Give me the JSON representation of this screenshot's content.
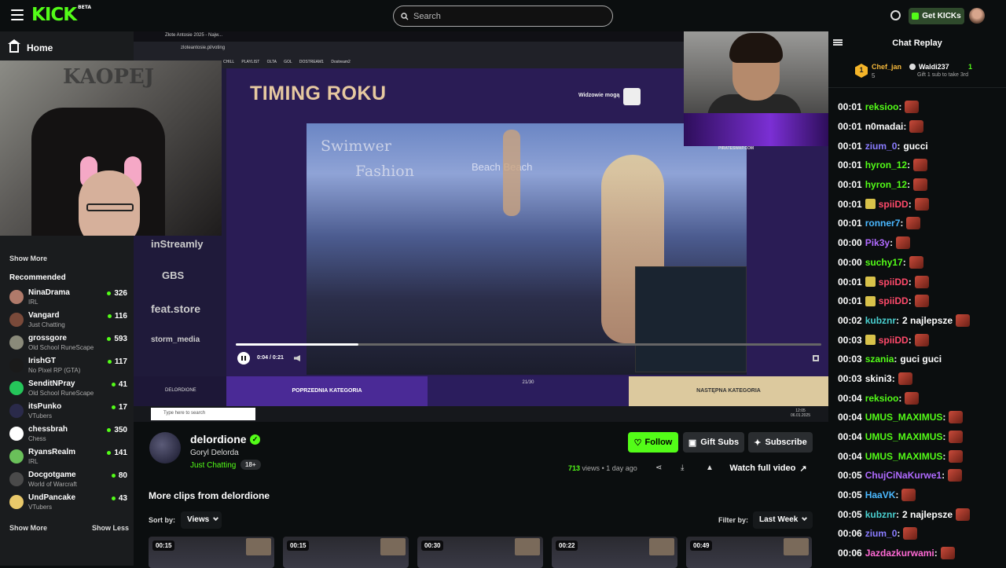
{
  "header": {
    "logo": "KICK",
    "logo_tag": "BETA",
    "search_placeholder": "Search",
    "get_kicks": "Get KICKs"
  },
  "sidebar": {
    "home": "Home",
    "show_more_top": "Show More",
    "recommended_title": "Recommended",
    "recommended": [
      {
        "name": "NinaDrama",
        "category": "IRL",
        "viewers": "326",
        "color": "#b07a6a"
      },
      {
        "name": "Vangard",
        "category": "Just Chatting",
        "viewers": "116",
        "color": "#7a4a3a"
      },
      {
        "name": "grossgore",
        "category": "Old School RuneScape",
        "viewers": "593",
        "color": "#8a8a7a"
      },
      {
        "name": "IrishGT",
        "category": "No Pixel RP (GTA)",
        "viewers": "117",
        "color": "#1a1a1a"
      },
      {
        "name": "SenditNPray",
        "category": "Old School RuneScape",
        "viewers": "41",
        "color": "#25c55a"
      },
      {
        "name": "itsPunko",
        "category": "VTubers",
        "viewers": "17",
        "color": "#2a2a4a"
      },
      {
        "name": "chessbrah",
        "category": "Chess",
        "viewers": "350",
        "color": "#ffffff"
      },
      {
        "name": "RyansRealm",
        "category": "IRL",
        "viewers": "141",
        "color": "#6ac05a"
      },
      {
        "name": "Docgotgame",
        "category": "World of Warcraft",
        "viewers": "80",
        "color": "#4a4a4a"
      },
      {
        "name": "UndPancake",
        "category": "VTubers",
        "viewers": "43",
        "color": "#e8c86a"
      }
    ],
    "show_more": "Show More",
    "show_less": "Show Less"
  },
  "video": {
    "browser_tab": "Złote Antosie 2025 - Najw...",
    "url": "zloteantosie.pl/voting",
    "bookmarks": "CHILL PLAYLIST  OLTA  GOL  DOSTREAM1  Dostream2",
    "title": "TIMING ROKU",
    "viewers_can": "Widzowie mogą",
    "runway_text1": "Swimwer",
    "runway_text2": "Fashion",
    "runway_text3": "Beach Beach",
    "brands": [
      "inStreamly",
      "GBS",
      "feat.store",
      "storm_media"
    ],
    "time": "0:04 / 0:21",
    "progress_fraction": 0.21,
    "nav_left": "DELORDIONE",
    "nav_prev": "POPRZEDNIA KATEGORIA",
    "nav_counter": "21/30",
    "nav_next": "NASTĘPNA KATEGORIA",
    "taskbar_search": "Type here to search",
    "taskbar_time": "12:05",
    "taskbar_date": "06.01.2025",
    "cam_caption": "PIRATESWAP.COM",
    "poster_text": "KAOPEJ"
  },
  "chat": {
    "title": "Chat Replay",
    "top_gifters": [
      {
        "rank": "1",
        "name": "Chef_jan",
        "count": "5"
      },
      {
        "name": "Waldi237",
        "count": "1",
        "note": "Gift 1 sub to take 3rd"
      }
    ],
    "messages": [
      {
        "time": "00:01",
        "user": "reksioo",
        "color": "#53fc18",
        "text": "",
        "emote": true
      },
      {
        "time": "00:01",
        "user": "n0madai",
        "color": "#ffffff",
        "text": "",
        "emote": true
      },
      {
        "time": "00:01",
        "user": "zium_0",
        "color": "#8a7cff",
        "text": "gucci",
        "emote": false
      },
      {
        "time": "00:01",
        "user": "hyron_12",
        "color": "#53fc18",
        "text": "",
        "emote": true
      },
      {
        "time": "00:01",
        "user": "hyron_12",
        "color": "#53fc18",
        "text": "",
        "emote": true
      },
      {
        "time": "00:01",
        "user": "spiiDD",
        "color": "#ff4a6a",
        "text": "",
        "emote": true,
        "badge": true
      },
      {
        "time": "00:01",
        "user": "ronner7",
        "color": "#4ab8ff",
        "text": "",
        "emote": true
      },
      {
        "time": "00:00",
        "user": "Pik3y",
        "color": "#b06aff",
        "text": "",
        "emote": true
      },
      {
        "time": "00:00",
        "user": "suchy17",
        "color": "#53fc18",
        "text": "",
        "emote": true
      },
      {
        "time": "00:01",
        "user": "spiiDD",
        "color": "#ff4a6a",
        "text": "",
        "emote": true,
        "badge": true
      },
      {
        "time": "00:01",
        "user": "spiiDD",
        "color": "#ff4a6a",
        "text": "",
        "emote": true,
        "badge": true
      },
      {
        "time": "00:02",
        "user": "kubznr",
        "color": "#4ad0d0",
        "text": "2 najlepsze",
        "emote": true
      },
      {
        "time": "00:03",
        "user": "spiiDD",
        "color": "#ff4a6a",
        "text": "",
        "emote": true,
        "badge": true
      },
      {
        "time": "00:03",
        "user": "szania",
        "color": "#53fc18",
        "text": "guci guci",
        "emote": false
      },
      {
        "time": "00:03",
        "user": "skini3",
        "color": "#ffffff",
        "text": "",
        "emote": true
      },
      {
        "time": "00:04",
        "user": "reksioo",
        "color": "#53fc18",
        "text": "",
        "emote": true
      },
      {
        "time": "00:04",
        "user": "UMUS_MAXIMUS",
        "color": "#53fc18",
        "text": "",
        "emote": true
      },
      {
        "time": "00:04",
        "user": "UMUS_MAXIMUS",
        "color": "#53fc18",
        "text": "",
        "emote": true
      },
      {
        "time": "00:04",
        "user": "UMUS_MAXIMUS",
        "color": "#53fc18",
        "text": "",
        "emote": true
      },
      {
        "time": "00:05",
        "user": "ChujCiNaKurwe1",
        "color": "#b06aff",
        "text": "",
        "emote": true
      },
      {
        "time": "00:05",
        "user": "HaaVK",
        "color": "#4ab8ff",
        "text": "",
        "emote": true
      },
      {
        "time": "00:05",
        "user": "kubznr",
        "color": "#4ad0d0",
        "text": "2 najlepsze",
        "emote": true
      },
      {
        "time": "00:06",
        "user": "zium_0",
        "color": "#8a7cff",
        "text": "",
        "emote": true
      },
      {
        "time": "00:06",
        "user": "Jazdazkurwami",
        "color": "#ff6ad5",
        "text": "",
        "emote": true
      }
    ]
  },
  "info": {
    "channel": "delordione",
    "stream_title": "Goryl Delorda",
    "category": "Just Chatting",
    "age": "18+",
    "follow": "Follow",
    "gift_subs": "Gift Subs",
    "subscribe": "Subscribe",
    "views_count": "713",
    "views_label": "views",
    "posted": "1 day ago",
    "watch_full": "Watch full video",
    "more_clips": "More clips from delordione",
    "sort_label": "Sort by:",
    "sort_value": "Views",
    "filter_label": "Filter by:",
    "filter_value": "Last Week",
    "clips": [
      {
        "duration": "00:15"
      },
      {
        "duration": "00:15"
      },
      {
        "duration": "00:30"
      },
      {
        "duration": "00:22"
      },
      {
        "duration": "00:49"
      }
    ]
  }
}
